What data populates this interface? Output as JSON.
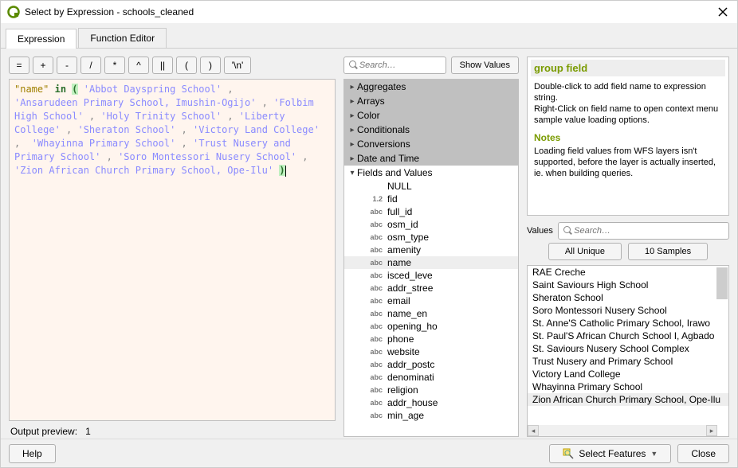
{
  "window": {
    "title": "Select by Expression - schools_cleaned"
  },
  "tabs": {
    "expression": "Expression",
    "function_editor": "Function Editor"
  },
  "operators": [
    "=",
    "+",
    "-",
    "/",
    "*",
    "^",
    "||",
    "(",
    ")",
    "'\\n'"
  ],
  "expression_tokens": [
    {
      "t": "field",
      "v": "\"name\""
    },
    {
      "t": "txt",
      "v": " "
    },
    {
      "t": "kw",
      "v": "in"
    },
    {
      "t": "txt",
      "v": " "
    },
    {
      "t": "paren",
      "v": "("
    },
    {
      "t": "txt",
      "v": " "
    },
    {
      "t": "str",
      "v": "'Abbot Dayspring School'"
    },
    {
      "t": "punc",
      "v": " ,\n"
    },
    {
      "t": "str",
      "v": "'Ansarudeen Primary School, Imushin-Ogijo'"
    },
    {
      "t": "punc",
      "v": " , "
    },
    {
      "t": "str",
      "v": "'Folbim High School'"
    },
    {
      "t": "punc",
      "v": " , "
    },
    {
      "t": "str",
      "v": "'Holy Trinity School'"
    },
    {
      "t": "punc",
      "v": " , "
    },
    {
      "t": "str",
      "v": "'Liberty College'"
    },
    {
      "t": "punc",
      "v": " , "
    },
    {
      "t": "str",
      "v": "'Sheraton School'"
    },
    {
      "t": "punc",
      "v": " , "
    },
    {
      "t": "str",
      "v": "'Victory Land College'"
    },
    {
      "t": "punc",
      "v": " ,  "
    },
    {
      "t": "str",
      "v": "'Whayinna Primary School'"
    },
    {
      "t": "punc",
      "v": " , "
    },
    {
      "t": "str",
      "v": "'Trust Nusery and Primary School'"
    },
    {
      "t": "punc",
      "v": " , "
    },
    {
      "t": "str",
      "v": "'Soro Montessori Nusery School'"
    },
    {
      "t": "punc",
      "v": " , "
    },
    {
      "t": "str",
      "v": "'Zion African Church Primary School, Ope-Ilu'"
    },
    {
      "t": "txt",
      "v": " "
    },
    {
      "t": "paren",
      "v": ")"
    }
  ],
  "preview": {
    "label": "Output preview:",
    "value": "1"
  },
  "mid": {
    "search_placeholder": "Search…",
    "show_values": "Show Values",
    "categories": [
      {
        "name": "Aggregates",
        "open": false
      },
      {
        "name": "Arrays",
        "open": false
      },
      {
        "name": "Color",
        "open": false
      },
      {
        "name": "Conditionals",
        "open": false
      },
      {
        "name": "Conversions",
        "open": false
      },
      {
        "name": "Date and Time",
        "open": false
      },
      {
        "name": "Fields and Values",
        "open": true,
        "children": [
          {
            "label": "NULL",
            "type": ""
          },
          {
            "label": "fid",
            "type": "1.2"
          },
          {
            "label": "full_id",
            "type": "abc"
          },
          {
            "label": "osm_id",
            "type": "abc"
          },
          {
            "label": "osm_type",
            "type": "abc"
          },
          {
            "label": "amenity",
            "type": "abc"
          },
          {
            "label": "name",
            "type": "abc",
            "selected": true
          },
          {
            "label": "isced_leve",
            "type": "abc"
          },
          {
            "label": "addr_stree",
            "type": "abc"
          },
          {
            "label": "email",
            "type": "abc"
          },
          {
            "label": "name_en",
            "type": "abc"
          },
          {
            "label": "opening_ho",
            "type": "abc"
          },
          {
            "label": "phone",
            "type": "abc"
          },
          {
            "label": "website",
            "type": "abc"
          },
          {
            "label": "addr_postc",
            "type": "abc"
          },
          {
            "label": "denominati",
            "type": "abc"
          },
          {
            "label": "religion",
            "type": "abc"
          },
          {
            "label": "addr_house",
            "type": "abc"
          },
          {
            "label": "min_age",
            "type": "abc"
          }
        ]
      }
    ]
  },
  "help": {
    "title": "group field",
    "body1": "Double-click to add field name to expression string.",
    "body2": "Right-Click on field name to open context menu sample value loading options.",
    "notes_title": "Notes",
    "notes_body": "Loading field values from WFS layers isn't supported, before the layer is actually inserted, ie. when building queries."
  },
  "values": {
    "label": "Values",
    "search_placeholder": "Search…",
    "all_unique": "All Unique",
    "samples": "10 Samples",
    "items": [
      {
        "v": "RAE Creche"
      },
      {
        "v": "Saint Saviours High School"
      },
      {
        "v": "Sheraton School"
      },
      {
        "v": "Soro Montessori Nusery School"
      },
      {
        "v": "St. Anne'S Catholic Primary School, Irawo"
      },
      {
        "v": "St. Paul'S African Church School I, Agbado"
      },
      {
        "v": "St. Saviours Nusery School Complex"
      },
      {
        "v": "Trust Nusery and Primary School"
      },
      {
        "v": "Victory Land College"
      },
      {
        "v": "Whayinna Primary School"
      },
      {
        "v": "Zion African Church Primary School, Ope-Ilu",
        "hl": true
      }
    ]
  },
  "footer": {
    "help": "Help",
    "select_features": "Select Features",
    "close": "Close"
  }
}
